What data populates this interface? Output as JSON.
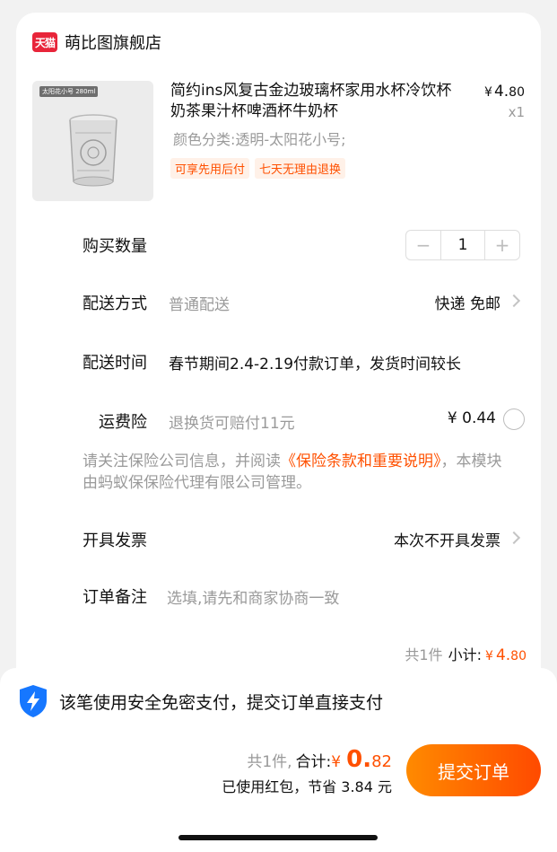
{
  "store": {
    "logo_text": "天猫",
    "name": "萌比图旗舰店"
  },
  "product": {
    "image_tag": "太阳花小号 280ml",
    "title": "简约ins风复古金边玻璃杯家用水杯冷饮杯奶茶果汁杯啤酒杯牛奶杯",
    "variant": "颜色分类:透明-太阳花小号;",
    "tags": [
      "可享先用后付",
      "七天无理由退换"
    ],
    "price_symbol": "¥",
    "price_int": "4.",
    "price_dec": "80",
    "quantity_text": "x1"
  },
  "rows": {
    "quantity": {
      "label": "购买数量",
      "value": "1",
      "minus": "−",
      "plus": "+"
    },
    "delivery_method": {
      "label": "配送方式",
      "value": "普通配送",
      "right": "快递 免邮"
    },
    "delivery_time": {
      "label": "配送时间",
      "value": "春节期间2.4-2.19付款订单，发货时间较长"
    },
    "insurance": {
      "label": "运费险",
      "value": "退换货可赔付11元",
      "price": "¥ 0.44"
    },
    "invoice": {
      "label": "开具发票",
      "right": "本次不开具发票"
    },
    "remark": {
      "label": "订单备注",
      "placeholder": "选填,请先和商家协商一致"
    }
  },
  "notice": {
    "prefix": "请关注保险公司信息，并阅读",
    "link": "《保险条款和重要说明》",
    "suffix": "，本模块由蚂蚁保保险代理有限公司管理。"
  },
  "subtotal": {
    "count": "共1件",
    "label": "小计:",
    "yen": "¥",
    "int": "4.",
    "dec": "80"
  },
  "secure": {
    "text": "该笔使用安全免密支付，提交订单直接支付"
  },
  "bottom": {
    "count": "共1件,",
    "total_label": "合计:",
    "yen": "¥",
    "total_int": "0.",
    "total_dec": "82",
    "saved": "已使用红包，节省 3.84 元",
    "submit": "提交订单"
  },
  "colors": {
    "accent": "#ff5000",
    "tmall_red": "#e8253a",
    "shield_blue": "#1677ff"
  }
}
